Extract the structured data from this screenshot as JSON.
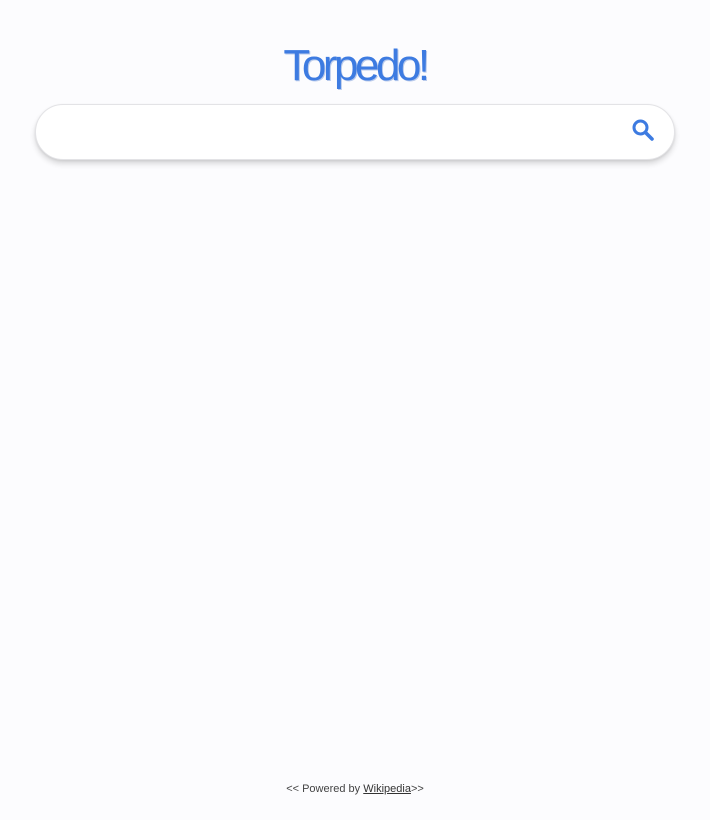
{
  "brand": {
    "logo_text": "Torpedo!",
    "color": "#3d7be1"
  },
  "search": {
    "value": "",
    "placeholder": "",
    "button_icon": "search-icon"
  },
  "footer": {
    "prefix": "<< Powered by ",
    "link_label": "Wikipedia",
    "suffix": ">>"
  }
}
